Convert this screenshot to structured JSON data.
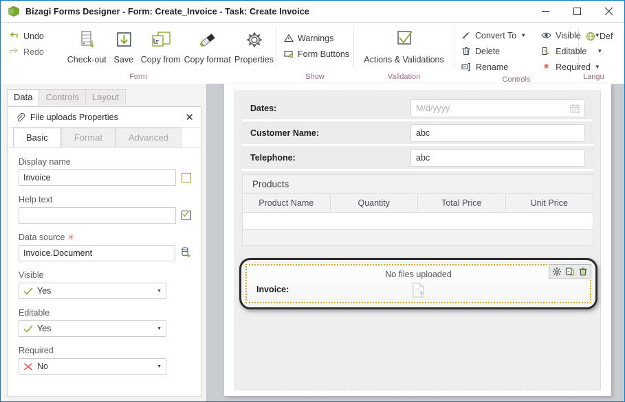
{
  "window": {
    "title": "Bizagi Forms Designer  - Form: Create_Invoice - Task:  Create Invoice",
    "logo_icon": "bizagi-cube-icon",
    "minimize_label": "–",
    "maximize_label": "❐",
    "close_label": "✕"
  },
  "ribbon": {
    "groups": [
      {
        "name": "form",
        "title": "Form",
        "small_commands": [
          {
            "label": "Undo",
            "icon": "undo-arrow-icon"
          },
          {
            "label": "Redo",
            "icon": "redo-arrow-icon"
          }
        ],
        "big_commands": [
          {
            "label": "Check-out",
            "icon": "check-out-icon"
          },
          {
            "label": "Save",
            "icon": "save-download-icon"
          },
          {
            "label": "Copy from",
            "icon": "copy-from-icon"
          },
          {
            "label": "Copy format",
            "icon": "copy-format-brush-icon"
          },
          {
            "label": "Properties",
            "icon": "gear-properties-icon"
          }
        ]
      },
      {
        "name": "show",
        "title": "Show",
        "small_commands": [
          {
            "label": "Warnings",
            "icon": "warning-triangle-icon"
          },
          {
            "label": "Form Buttons",
            "icon": "form-buttons-icon"
          }
        ],
        "big_commands": []
      },
      {
        "name": "validation",
        "title": "Validation",
        "small_commands": [],
        "big_commands": [
          {
            "label": "Actions & Validations",
            "icon": "checkmark-box-icon"
          }
        ]
      },
      {
        "name": "controls",
        "title": "Controls",
        "small_commands": [
          {
            "label": "Convert To",
            "icon": "convert-to-wand-icon",
            "has_caret": true
          },
          {
            "label": "Delete",
            "icon": "trash-icon",
            "has_caret": false
          },
          {
            "label": "Rename",
            "icon": "rename-icon",
            "has_caret": false
          },
          {
            "label": "Visible",
            "icon": "eye-icon",
            "has_caret": true
          },
          {
            "label": "Editable",
            "icon": "editable-pencil-icon",
            "has_caret": true
          },
          {
            "label": "Required",
            "icon": "required-asterisk-icon",
            "has_caret": true
          }
        ],
        "big_commands": []
      },
      {
        "name": "language",
        "title": "Langu",
        "small_commands": [
          {
            "label": "Def",
            "icon": "globe-icon",
            "has_caret": false
          }
        ],
        "big_commands": []
      }
    ]
  },
  "left_panel": {
    "tabs": [
      {
        "label": "Data",
        "active": true
      },
      {
        "label": "Controls",
        "active": false
      },
      {
        "label": "Layout",
        "active": false
      }
    ],
    "properties_panel": {
      "icon": "paperclip-icon",
      "title": "File uploads Properties",
      "close_label": "✕",
      "subtabs": [
        {
          "label": "Basic",
          "active": true
        },
        {
          "label": "Format",
          "active": false
        },
        {
          "label": "Advanced",
          "active": false
        }
      ],
      "fields": [
        {
          "label": "Display name",
          "type": "text",
          "value": "Invoice",
          "placeholder": "",
          "required": false,
          "side_icon": "empty-checkbox-icon"
        },
        {
          "label": "Help text",
          "type": "text",
          "value": "",
          "placeholder": "",
          "required": false,
          "side_icon": "checked-checkbox-icon"
        },
        {
          "label": "Data source",
          "type": "text",
          "value": "Invoice.Document",
          "placeholder": "",
          "required": true,
          "side_icon": "database-add-icon"
        },
        {
          "label": "Visible",
          "type": "select",
          "value": "Yes",
          "state_icon": "green-check-icon"
        },
        {
          "label": "Editable",
          "type": "select",
          "value": "Yes",
          "state_icon": "green-check-icon"
        },
        {
          "label": "Required",
          "type": "select",
          "value": "No",
          "state_icon": "red-x-icon"
        }
      ]
    }
  },
  "form_canvas": {
    "rows": [
      {
        "label": "Dates:",
        "control": "date",
        "value": "",
        "placeholder": "M/d/yyyy",
        "icon": "calendar-icon"
      },
      {
        "label": "Customer Name:",
        "control": "text",
        "value": "abc",
        "placeholder": ""
      },
      {
        "label": "Telephone:",
        "control": "text",
        "value": "abc",
        "placeholder": ""
      }
    ],
    "grid": {
      "title": "Products",
      "columns": [
        "Product Name",
        "Quantity",
        "Total Price",
        "Unit Price"
      ],
      "rows": []
    },
    "file_upload": {
      "label": "Invoice:",
      "empty_message": "No files uploaded",
      "upload_icon": "document-upload-icon",
      "selected": true,
      "toolbar": [
        {
          "icon": "gear-icon",
          "name": "properties"
        },
        {
          "icon": "copy-icon",
          "name": "copy"
        },
        {
          "icon": "trash-icon",
          "name": "delete"
        }
      ]
    }
  },
  "colors": {
    "accent": "#76a832",
    "selection_border": "#2b2b2b",
    "selection_dotted": "#e0a32e",
    "group_title": "#9b6a82",
    "required": "#e8645a",
    "window_border": "#0a7bc4"
  }
}
